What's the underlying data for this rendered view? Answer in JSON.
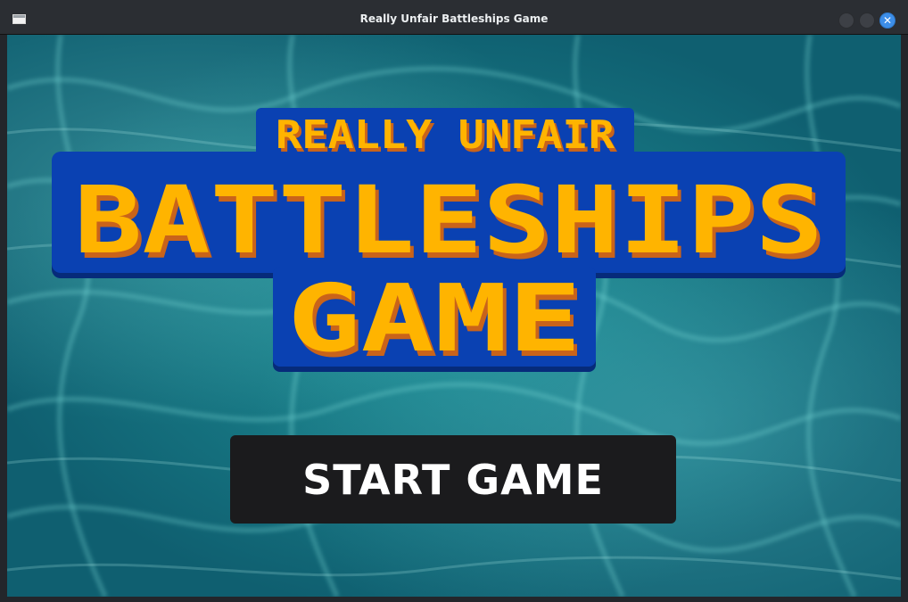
{
  "window": {
    "title": "Really Unfair Battleships Game",
    "close_glyph": "✕"
  },
  "logo": {
    "line1": "REALLY UNFAIR",
    "line2": "BATTLESHIPS",
    "line3": "GAME"
  },
  "start_button": {
    "label": "START GAME"
  },
  "colors": {
    "logo_blue": "#0a41b2",
    "letter_yellow": "#ffb400",
    "letter_shadow": "#c9631a",
    "button_bg": "#1b1b1d",
    "water": "#1f8f96"
  },
  "icons": [
    "app-window-icon",
    "minimize-icon",
    "maximize-icon",
    "close-icon"
  ]
}
